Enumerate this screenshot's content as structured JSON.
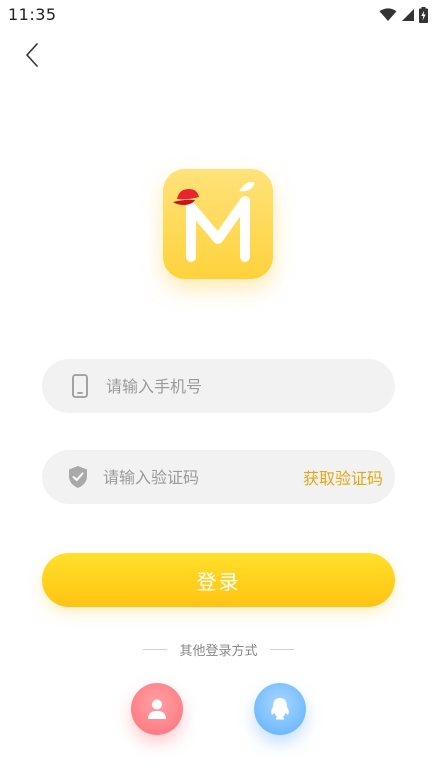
{
  "status_bar": {
    "time": "11:35"
  },
  "login": {
    "phone_placeholder": "请输入手机号",
    "code_placeholder": "请输入验证码",
    "get_code_label": "获取验证码",
    "submit_label": "登录",
    "other_methods_label": "其他登录方式"
  },
  "icons": {
    "back": "chevron-left-icon",
    "phone": "phone-icon",
    "shield": "shield-check-icon",
    "account": "user-icon",
    "qq": "qq-icon"
  },
  "colors": {
    "accent": "#ffcf1f",
    "get_code_text": "#e3a817",
    "account_button": "#ff7c84",
    "qq_button": "#6fb8ff"
  }
}
